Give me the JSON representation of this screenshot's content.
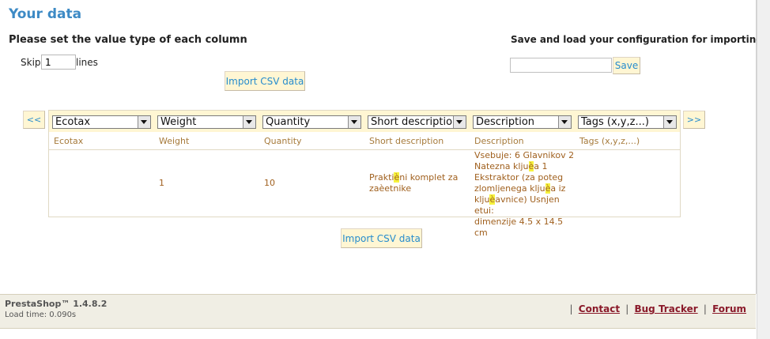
{
  "page": {
    "title": "Your data",
    "subtitle": "Please set the value type of each column"
  },
  "skip": {
    "label": "Skip",
    "value": "1",
    "suffix": "lines"
  },
  "import_button_label": "Import CSV data",
  "config": {
    "title": "Save and load your configuration for importing files :",
    "input_value": "",
    "save_label": "Save"
  },
  "nav": {
    "prev": "<<",
    "next": ">>"
  },
  "columns": [
    {
      "select": "Ecotax",
      "header": "Ecotax"
    },
    {
      "select": "Weight",
      "header": "Weight"
    },
    {
      "select": "Quantity",
      "header": "Quantity"
    },
    {
      "select": "Short description",
      "header": "Short description"
    },
    {
      "select": "Description",
      "header": "Description"
    },
    {
      "select": "Tags (x,y,z...)",
      "header": "Tags (x,y,z,...)"
    }
  ],
  "row": {
    "ecotax": "",
    "weight": "1",
    "quantity": "10",
    "short_description": {
      "p1": "Prakti",
      "h1": "è",
      "p2": "ni komplet za",
      "p3": "zaèetnike"
    },
    "description": {
      "l1": "Vsebuje: 6 Glavnikov 2",
      "l2a": "Natezna klju",
      "l2h": "è",
      "l2b": "a 1",
      "l3a": "Ekstraktor (za poteg",
      "l4a": "zlomljenega klju",
      "l4h": "è",
      "l4b": "a iz",
      "l5a": "klju",
      "l5h": "è",
      "l5b": "avnice) Usnjen etui:",
      "l6": "dimenzije 4.5 x 14.5 cm"
    },
    "tags": ""
  },
  "footer": {
    "brand": "PrestaShop™ 1.4.8.2",
    "load_time": "Load time: 0.090s",
    "links": {
      "contact": "Contact",
      "bug_tracker": "Bug Tracker",
      "forum": "Forum"
    },
    "separator": "|"
  }
}
